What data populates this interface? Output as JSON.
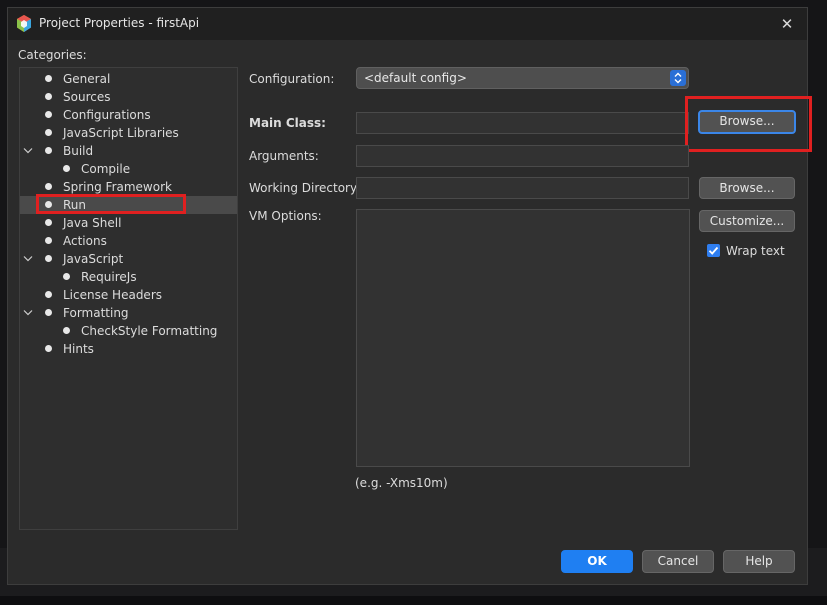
{
  "window": {
    "title": "Project Properties - firstApi",
    "close_glyph": "✕"
  },
  "categories": {
    "label": "Categories:",
    "items": [
      {
        "label": "General",
        "level": 0,
        "expandable": false
      },
      {
        "label": "Sources",
        "level": 0,
        "expandable": false
      },
      {
        "label": "Configurations",
        "level": 0,
        "expandable": false
      },
      {
        "label": "JavaScript Libraries",
        "level": 0,
        "expandable": false
      },
      {
        "label": "Build",
        "level": 0,
        "expandable": true
      },
      {
        "label": "Compile",
        "level": 1,
        "expandable": false
      },
      {
        "label": "Spring Framework",
        "level": 0,
        "expandable": false
      },
      {
        "label": "Run",
        "level": 0,
        "expandable": false,
        "selected": true
      },
      {
        "label": "Java Shell",
        "level": 0,
        "expandable": false
      },
      {
        "label": "Actions",
        "level": 0,
        "expandable": false
      },
      {
        "label": "JavaScript",
        "level": 0,
        "expandable": true
      },
      {
        "label": "RequireJs",
        "level": 1,
        "expandable": false
      },
      {
        "label": "License Headers",
        "level": 0,
        "expandable": false
      },
      {
        "label": "Formatting",
        "level": 0,
        "expandable": true
      },
      {
        "label": "CheckStyle Formatting",
        "level": 1,
        "expandable": false
      },
      {
        "label": "Hints",
        "level": 0,
        "expandable": false
      }
    ]
  },
  "form": {
    "configuration_label": "Configuration:",
    "configuration_value": "<default config>",
    "main_class_label": "Main Class:",
    "main_class_value": "",
    "arguments_label": "Arguments:",
    "arguments_value": "",
    "working_dir_label": "Working Directory:",
    "working_dir_value": "",
    "vm_options_label": "VM Options:",
    "vm_options_value": "",
    "vm_options_hint": "(e.g. -Xms10m)",
    "browse_main_label": "Browse...",
    "browse_dir_label": "Browse...",
    "customize_label": "Customize...",
    "wrap_text_label": "Wrap text",
    "wrap_text_checked": true
  },
  "footer": {
    "ok_label": "OK",
    "cancel_label": "Cancel",
    "help_label": "Help"
  },
  "colors": {
    "accent": "#1f7ff2",
    "highlight": "#e02020",
    "background": "#2b2b2b"
  }
}
